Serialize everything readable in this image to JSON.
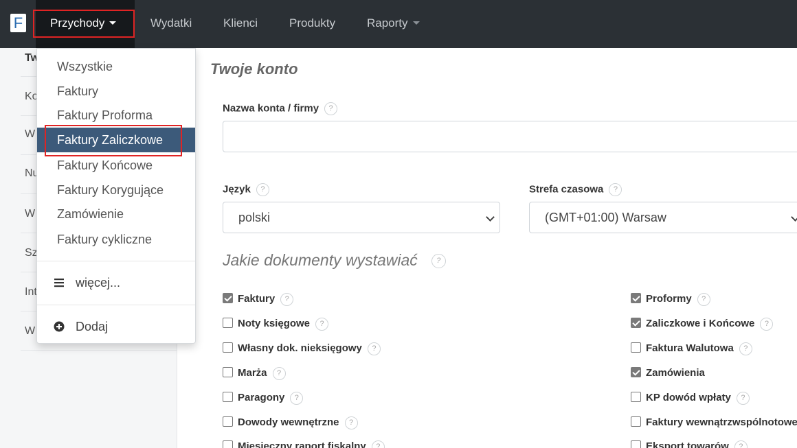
{
  "nav": {
    "logo_letter": "F",
    "items": [
      {
        "label": "Przychody",
        "active": true
      },
      {
        "label": "Wydatki"
      },
      {
        "label": "Klienci"
      },
      {
        "label": "Produkty"
      },
      {
        "label": "Raporty"
      }
    ]
  },
  "sidebar": {
    "items": [
      "Tw",
      "Ko",
      "W",
      "Nu",
      "W",
      "Sz",
      "Int",
      "W"
    ]
  },
  "dropdown": {
    "items": [
      "Wszystkie",
      "Faktury",
      "Faktury Proforma",
      "Faktury Zaliczkowe",
      "Faktury Końcowe",
      "Faktury Korygujące",
      "Zamówienie",
      "Faktury cykliczne"
    ],
    "highlighted_index": 3,
    "more_label": "więcej...",
    "add_label": "Dodaj"
  },
  "main": {
    "title": "Twoje konto",
    "account_name_label": "Nazwa konta / firmy",
    "account_name_value": "",
    "language_label": "Język",
    "language_value": "polski",
    "timezone_label": "Strefa czasowa",
    "timezone_value": "(GMT+01:00) Warsaw",
    "documents_title": "Jakie dokumenty wystawiać",
    "help_glyph": "?",
    "documents_left": [
      {
        "label": "Faktury",
        "checked": true
      },
      {
        "label": "Noty księgowe",
        "checked": false
      },
      {
        "label": "Własny dok. nieksięgowy",
        "checked": false
      },
      {
        "label": "Marża",
        "checked": false
      },
      {
        "label": "Paragony",
        "checked": false
      },
      {
        "label": "Dowody wewnętrzne",
        "checked": false
      },
      {
        "label": "Miesięczny raport fiskalny",
        "checked": false
      }
    ],
    "documents_right": [
      {
        "label": "Proformy",
        "checked": true
      },
      {
        "label": "Zaliczkowe i Końcowe",
        "checked": true
      },
      {
        "label": "Faktura Walutowa",
        "checked": false
      },
      {
        "label": "Zamówienia",
        "checked": true
      },
      {
        "label": "KP dowód wpłaty",
        "checked": false
      },
      {
        "label": "Faktury wewnątrzwspólnotowe",
        "checked": false
      },
      {
        "label": "Eksport towarów",
        "checked": false
      }
    ]
  },
  "colors": {
    "navbar": "#2b3035",
    "highlight": "#3c5a7a",
    "annotation": "#e02424"
  }
}
